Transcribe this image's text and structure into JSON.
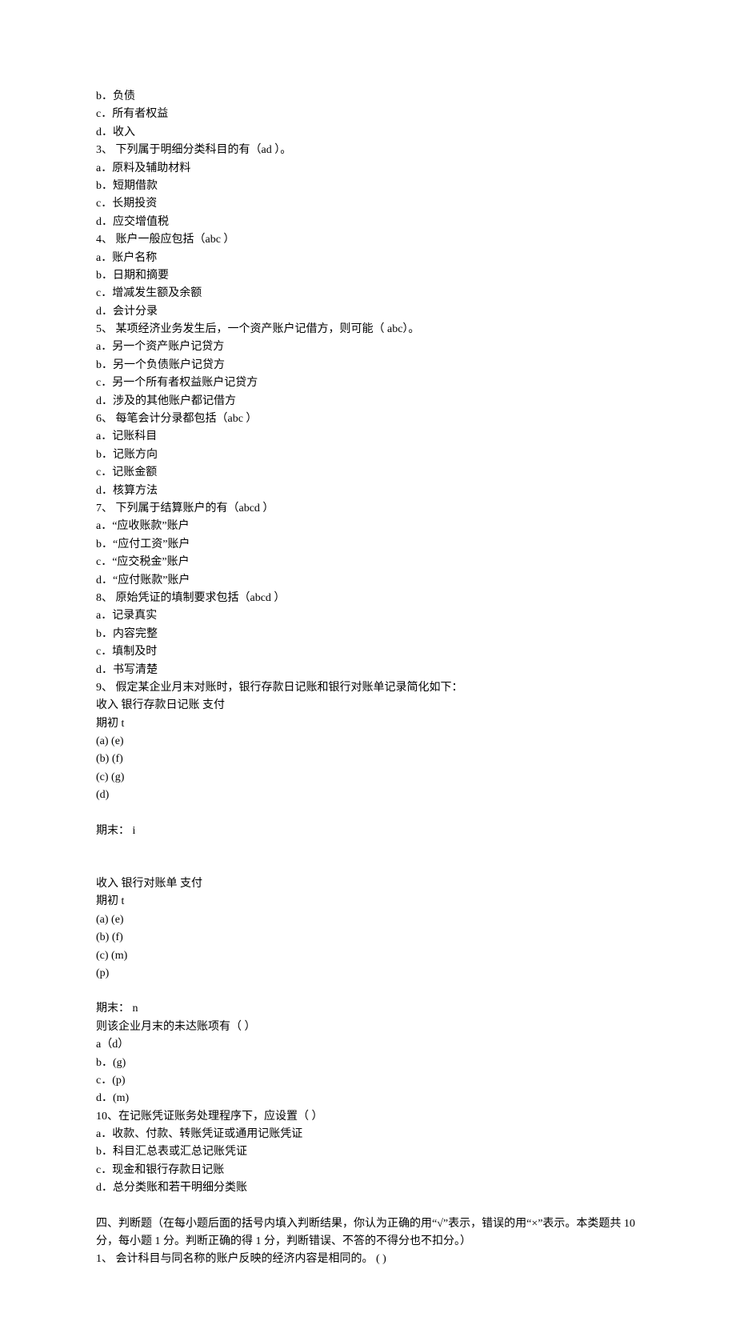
{
  "lines": [
    "b．负债",
    "c．所有者权益",
    "d．收入",
    "3、 下列属于明细分类科目的有（ad ）。",
    "a．原料及辅助材料",
    "b．短期借款",
    "c．长期投资",
    "d．应交增值税",
    "4、 账户一般应包括（abc ）",
    "a．账户名称",
    "b．日期和摘要",
    "c．增减发生额及余额",
    "d．会计分录",
    "5、 某项经济业务发生后，一个资产账户记借方，则可能（ abc）。",
    "a．另一个资产账户记贷方",
    "b．另一个负债账户记贷方",
    "c．另一个所有者权益账户记贷方",
    "d．涉及的其他账户都记借方",
    "6、 每笔会计分录都包括（abc ）",
    "a．记账科目",
    "b．记账方向",
    "c．记账金额",
    "d．核算方法",
    "7、 下列属于结算账户的有（abcd ）",
    "a．“应收账款”账户",
    "b．“应付工资”账户",
    "c．“应交税金”账户",
    "d．“应付账款”账户",
    "8、 原始凭证的填制要求包括（abcd ）",
    "a．记录真实",
    "b．内容完整",
    "c．填制及时",
    "d．书写清楚",
    "9、 假定某企业月末对账时，银行存款日记账和银行对账单记录简化如下：",
    "收入 银行存款日记账 支付",
    "期初 t",
    "(a) (e)",
    "(b) (f)",
    "(c) (g)",
    "(d)",
    "",
    "期末： i",
    "",
    "",
    "收入 银行对账单 支付",
    "期初 t",
    "(a) (e)",
    "(b) (f)",
    "(c) (m)",
    "(p)",
    "",
    "期末： n",
    "则该企业月末的未达账项有（ ）",
    "a（d）",
    "b．(g)",
    "c．(p)",
    "d．(m)",
    "10、在记账凭证账务处理程序下，应设置（ ）",
    "a．收款、付款、转账凭证或通用记账凭证",
    "b．科目汇总表或汇总记账凭证",
    "c．现金和银行存款日记账",
    "d．总分类账和若干明细分类账",
    "",
    "四、判断题（在每小题后面的括号内填入判断结果，你认为正确的用“√”表示，错误的用“×”表示。本类题共 10 分，每小题 1 分。判断正确的得 1 分，判断错误、不答的不得分也不扣分。）",
    "1、 会计科目与同名称的账户反映的经济内容是相同的。 ( )"
  ]
}
